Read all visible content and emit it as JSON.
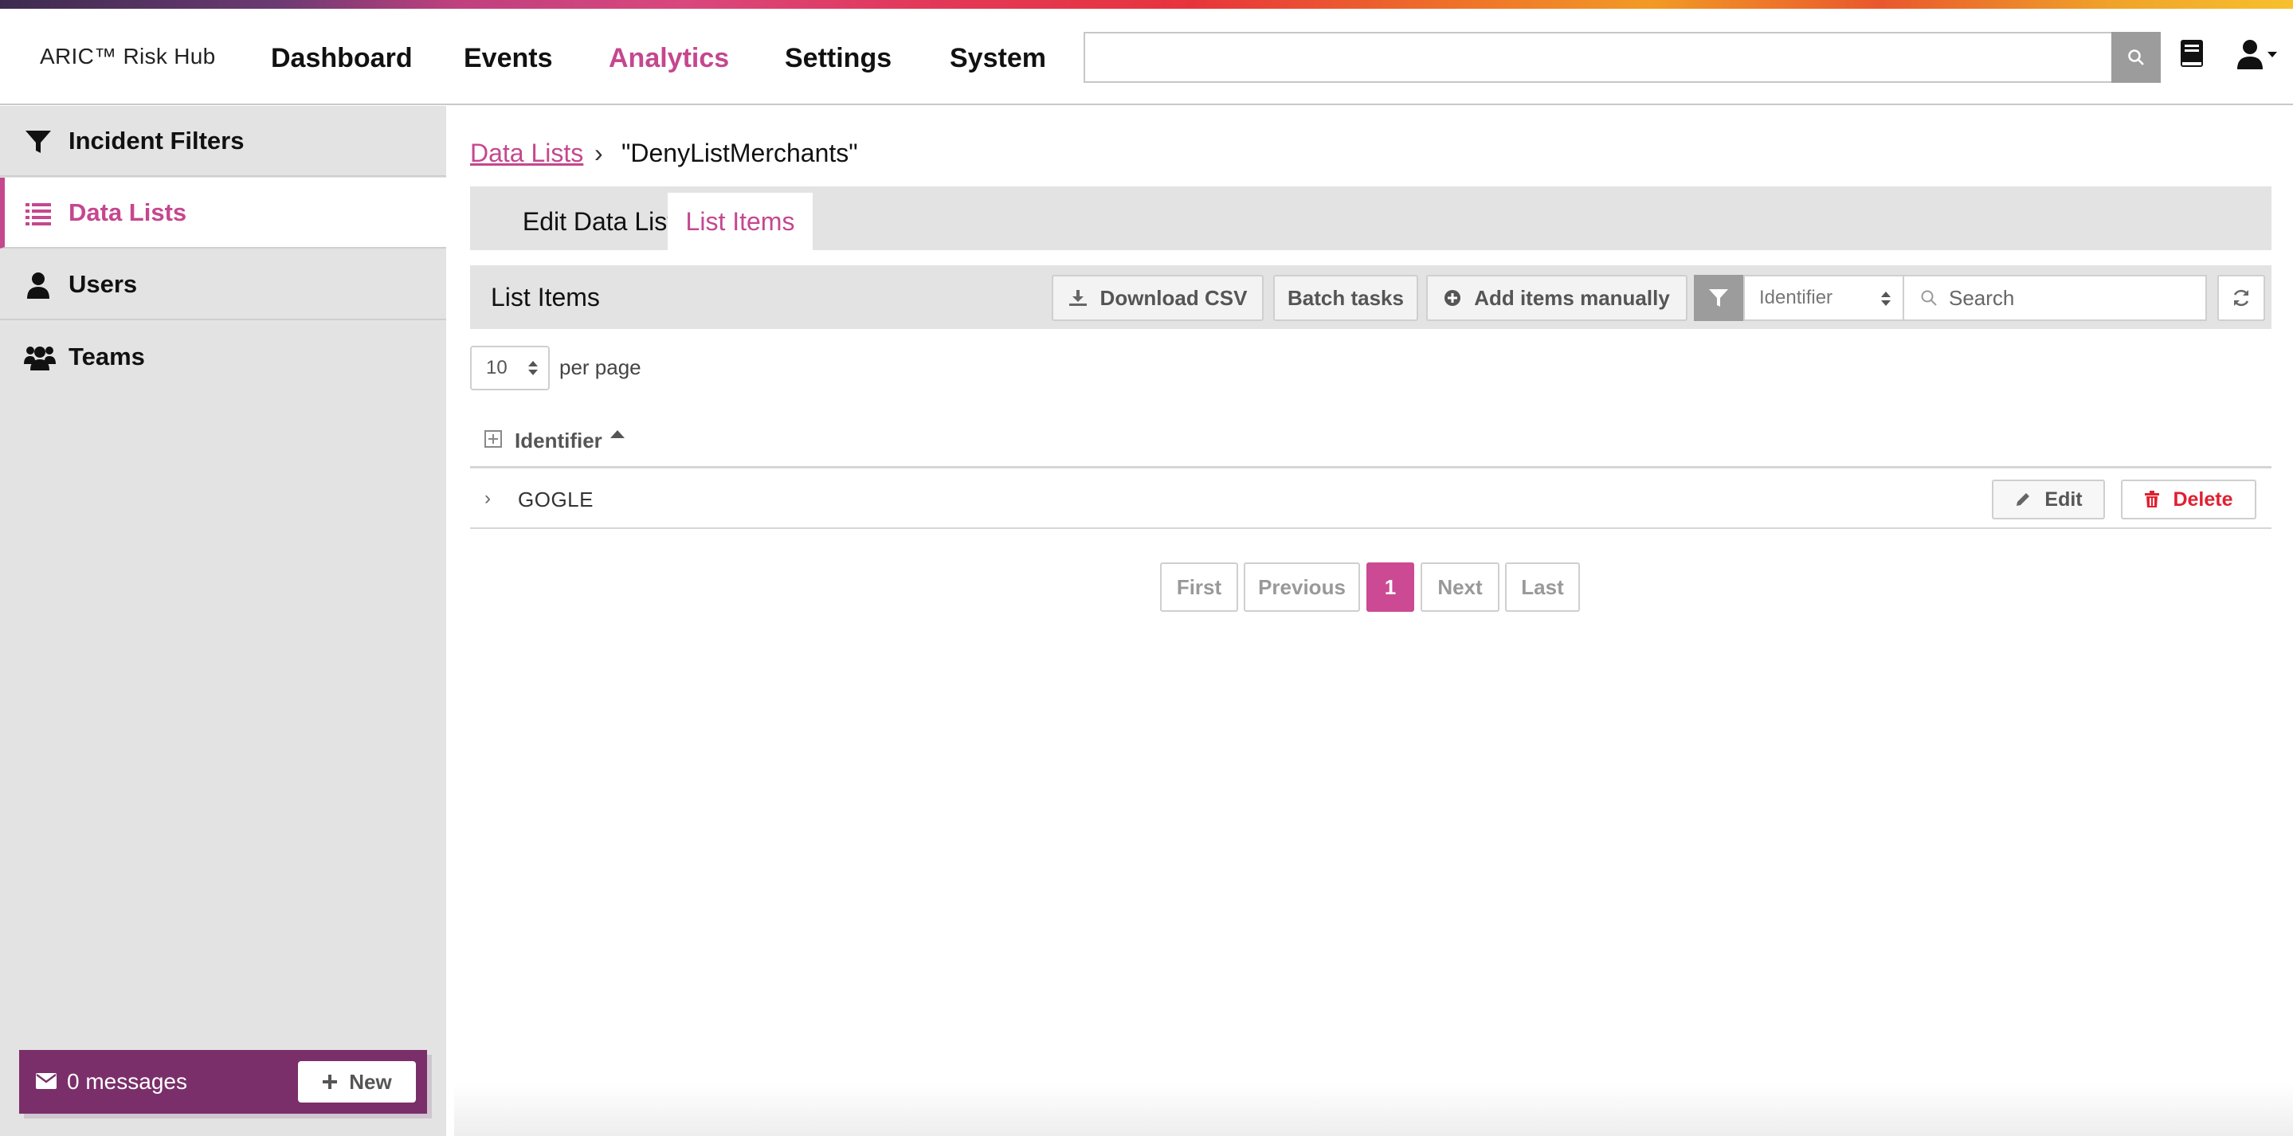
{
  "brand": "ARIC™ Risk Hub",
  "nav": [
    {
      "label": "Dashboard"
    },
    {
      "label": "Events"
    },
    {
      "label": "Analytics",
      "active": true
    },
    {
      "label": "Settings"
    },
    {
      "label": "System"
    }
  ],
  "header_search": {
    "placeholder": "",
    "value": ""
  },
  "sidebar": {
    "items": [
      {
        "label": "Incident Filters",
        "icon": "filter-icon"
      },
      {
        "label": "Data Lists",
        "icon": "list-icon",
        "active": true
      },
      {
        "label": "Users",
        "icon": "user-icon"
      },
      {
        "label": "Teams",
        "icon": "users-icon"
      }
    ],
    "messages": {
      "count_label": "0 messages",
      "new_label": "New"
    }
  },
  "breadcrumb": {
    "parent": "Data Lists",
    "separator": "›",
    "current": "\"DenyListMerchants\""
  },
  "tabs": [
    {
      "label": "Edit Data List"
    },
    {
      "label": "List Items",
      "active": true
    }
  ],
  "toolbar": {
    "title": "List Items",
    "download_label": "Download CSV",
    "batch_label": "Batch tasks",
    "add_label": "Add items manually",
    "filter_field": "Identifier",
    "search_placeholder": "Search"
  },
  "per_page": {
    "value": "10",
    "label": "per page"
  },
  "table": {
    "columns": [
      "Identifier"
    ],
    "rows": [
      {
        "identifier": "GOGLE",
        "edit_label": "Edit",
        "delete_label": "Delete"
      }
    ]
  },
  "pagination": {
    "first": "First",
    "previous": "Previous",
    "current": "1",
    "next": "Next",
    "last": "Last"
  },
  "colors": {
    "accent": "#c5478e",
    "danger": "#e02030",
    "sidebar_bg": "#e3e3e3",
    "message_bar": "#7a2f6a"
  }
}
